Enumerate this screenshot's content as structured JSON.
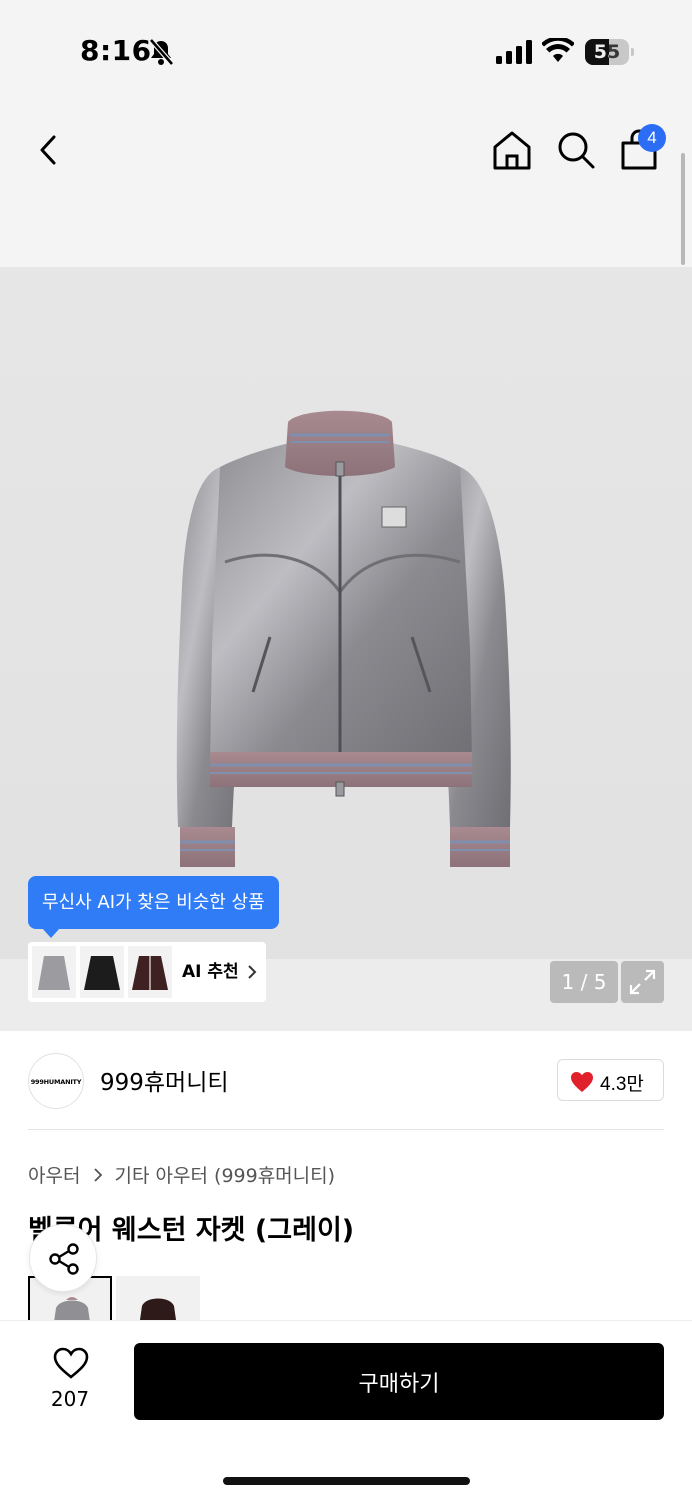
{
  "status_bar": {
    "time": "8:16",
    "battery": "55",
    "battery_level": 0.55
  },
  "nav": {
    "cart_count": "4",
    "icons": [
      "back-icon",
      "home-icon",
      "search-icon",
      "cart-icon"
    ]
  },
  "hero": {
    "ai_tooltip": "무신사 AI가 찾은 비슷한 상품",
    "ai_label": "AI 추천",
    "pager": "1 / 5"
  },
  "brand": {
    "logo_text": "999HUMANITY",
    "name": "999휴머니티",
    "likes": "4.3만"
  },
  "product": {
    "breadcrumb": [
      "아우터",
      "기타 아우터 (999휴머니티)"
    ],
    "title": "벨루어 웨스턴 자켓 (그레이)"
  },
  "bottom": {
    "wish_count": "207",
    "buy_label": "구매하기"
  },
  "colors": {
    "accent_blue": "#2b6ef5",
    "heart_red": "#e0202a",
    "buy_button": "#000000"
  }
}
